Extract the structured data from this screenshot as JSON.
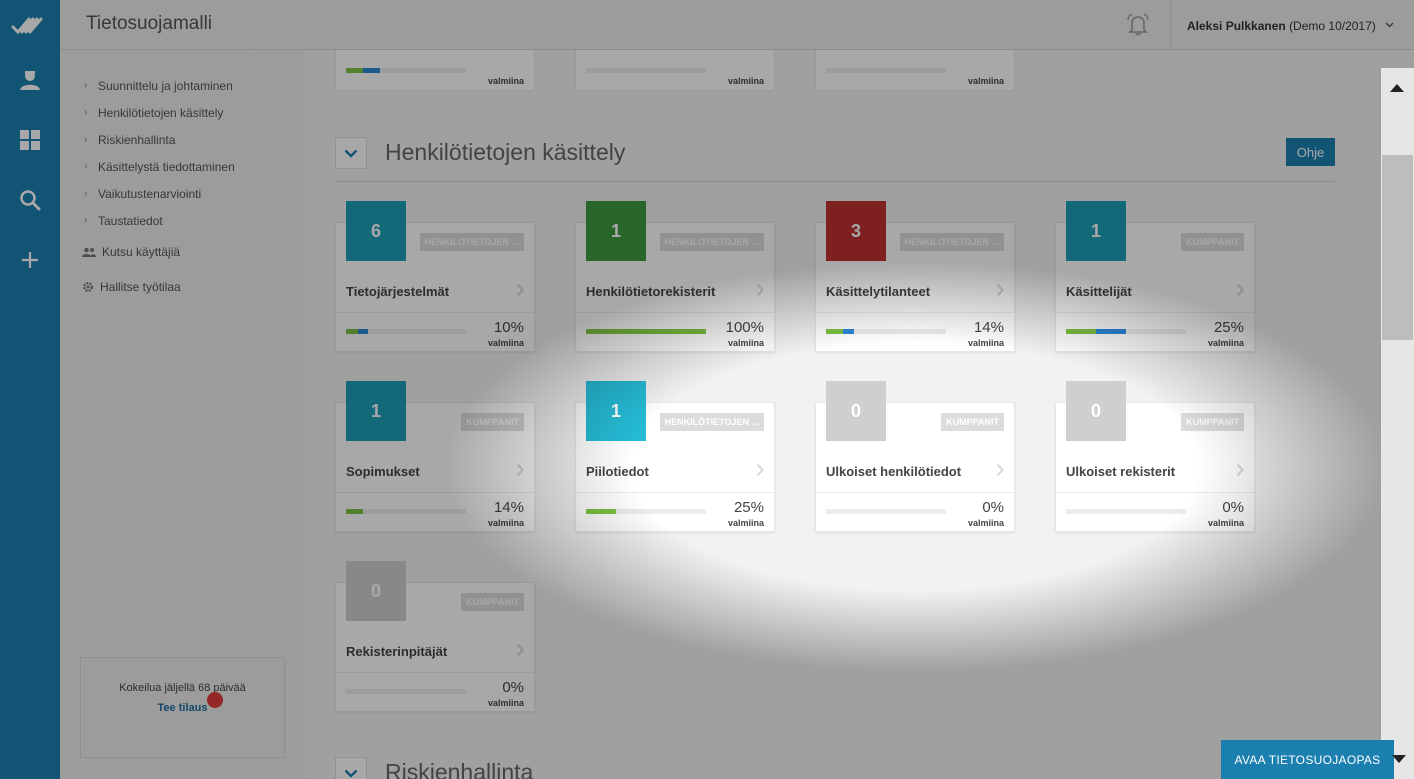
{
  "app": {
    "title": "Tietosuojamalli",
    "user_name": "Aleksi Pulkkanen",
    "user_org": "(Demo 10/2017)"
  },
  "sidebar": {
    "nav": [
      {
        "label": "Suunnittelu ja johtaminen"
      },
      {
        "label": "Henkilötietojen käsittely"
      },
      {
        "label": "Riskienhallinta"
      },
      {
        "label": "Käsittelystä tiedottaminen"
      },
      {
        "label": "Vaikutustenarviointi"
      },
      {
        "label": "Taustatiedot"
      }
    ],
    "invite_label": "Kutsu käyttäjiä",
    "manage_label": "Hallitse työtilaa",
    "trial_text": "Kokeilua jäljellä 68 päivää",
    "order_link": "Tee tilaus"
  },
  "top_partial": [
    {
      "pct_fraction": 0.14,
      "label": "valmiina"
    },
    {
      "pct_fraction": 0,
      "label": "valmiina"
    },
    {
      "pct_fraction": 0,
      "label": "valmiina"
    }
  ],
  "section": {
    "title": "Henkilötietojen käsittely",
    "help_label": "Ohje",
    "cards": [
      {
        "count": "6",
        "color": "#1e9fb8",
        "badge": "HENKILÖTIETOJEN ...",
        "name": "Tietojärjestelmät",
        "pct": "10%",
        "green": 0.1,
        "blue": 0.08,
        "valmiina": "valmiina"
      },
      {
        "count": "1",
        "color": "#3e9a3e",
        "badge": "HENKILÖTIETOJEN ...",
        "name": "Henkilötietorekisterit",
        "pct": "100%",
        "green": 1.0,
        "blue": 0,
        "valmiina": "valmiina"
      },
      {
        "count": "3",
        "color": "#c0302f",
        "badge": "HENKILÖTIETOJEN ...",
        "name": "Käsittelytilanteet",
        "pct": "14%",
        "green": 0.14,
        "blue": 0.09,
        "valmiina": "valmiina"
      },
      {
        "count": "1",
        "color": "#1e9fb8",
        "badge": "KUMPPANIT",
        "name": "Käsittelijät",
        "pct": "25%",
        "green": 0.25,
        "blue": 0.25,
        "valmiina": "valmiina"
      },
      {
        "count": "1",
        "color": "#1e9fb8",
        "badge": "KUMPPANIT",
        "name": "Sopimukset",
        "pct": "14%",
        "green": 0.14,
        "blue": 0,
        "valmiina": "valmiina"
      },
      {
        "count": "1",
        "color": "#25bcd6",
        "badge": "HENKILÖTIETOJEN ...",
        "name": "Piilotiedot",
        "pct": "25%",
        "green": 0.25,
        "blue": 0,
        "valmiina": "valmiina"
      },
      {
        "count": "0",
        "color": "#cfcfcf",
        "badge": "KUMPPANIT",
        "name": "Ulkoiset henkilötiedot",
        "pct": "0%",
        "green": 0,
        "blue": 0,
        "valmiina": "valmiina"
      },
      {
        "count": "0",
        "color": "#cfcfcf",
        "badge": "KUMPPANIT",
        "name": "Ulkoiset rekisterit",
        "pct": "0%",
        "green": 0,
        "blue": 0,
        "valmiina": "valmiina"
      },
      {
        "count": "0",
        "color": "#cfcfcf",
        "badge": "KUMPPANIT",
        "name": "Rekisterinpitäjät",
        "pct": "0%",
        "green": 0,
        "blue": 0,
        "valmiina": "valmiina"
      }
    ]
  },
  "next_section": {
    "title": "Riskienhallinta"
  },
  "guide_button": "AVAA TIETOSUOJAOPAS",
  "icons": [
    "logo-icon",
    "user-icon",
    "dashboard-icon",
    "search-icon",
    "add-icon",
    "bell-icon",
    "chevron-down-icon",
    "people-icon",
    "gear-icon",
    "chevron-right-icon"
  ]
}
